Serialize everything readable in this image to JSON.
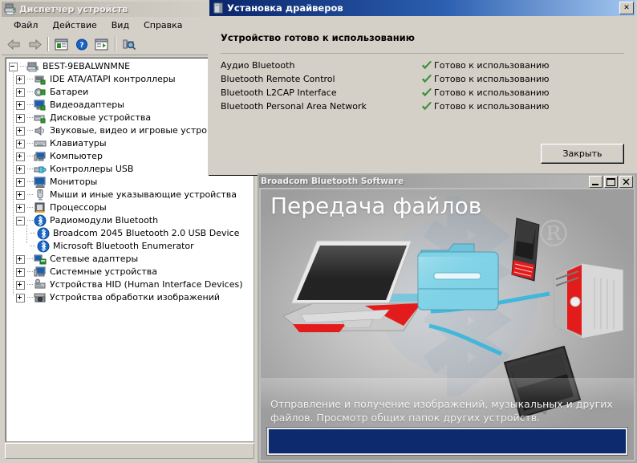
{
  "device_manager": {
    "title": "Диспетчер устройств",
    "title_icon": "device-manager-icon",
    "menu": [
      {
        "label": "Файл"
      },
      {
        "label": "Действие"
      },
      {
        "label": "Вид"
      },
      {
        "label": "Справка"
      }
    ],
    "toolbar": [
      {
        "name": "back-button",
        "icon": "left-arrow-icon"
      },
      {
        "name": "forward-button",
        "icon": "right-arrow-icon"
      },
      {
        "name": "properties-button",
        "icon": "window-properties-icon"
      },
      {
        "name": "help-button",
        "icon": "question-mark-icon"
      },
      {
        "name": "scan-button",
        "icon": "window-play-icon"
      },
      {
        "name": "scan-hardware-button",
        "icon": "scan-hardware-icon"
      }
    ],
    "tree": {
      "root": {
        "label": "BEST-9EBALWNMNE",
        "icon": "computer-icon",
        "expanded": true
      },
      "nodes": [
        {
          "label": "IDE ATA/ATAPI контроллеры",
          "icon": "ide-controller-icon",
          "expanded": false,
          "level": 1
        },
        {
          "label": "Батареи",
          "icon": "battery-icon",
          "expanded": false,
          "level": 1
        },
        {
          "label": "Видеоадаптеры",
          "icon": "display-adapter-icon",
          "expanded": false,
          "level": 1
        },
        {
          "label": "Дисковые устройства",
          "icon": "disk-drive-icon",
          "expanded": false,
          "level": 1
        },
        {
          "label": "Звуковые, видео и игровые устройства",
          "icon": "sound-device-icon",
          "expanded": false,
          "level": 1
        },
        {
          "label": "Клавиатуры",
          "icon": "keyboard-icon",
          "expanded": false,
          "level": 1
        },
        {
          "label": "Компьютер",
          "icon": "computer-node-icon",
          "expanded": false,
          "level": 1
        },
        {
          "label": "Контроллеры USB",
          "icon": "usb-controller-icon",
          "expanded": false,
          "level": 1
        },
        {
          "label": "Мониторы",
          "icon": "monitor-icon",
          "expanded": false,
          "level": 1
        },
        {
          "label": "Мыши и иные указывающие устройства",
          "icon": "mouse-icon",
          "expanded": false,
          "level": 1
        },
        {
          "label": "Процессоры",
          "icon": "processor-icon",
          "expanded": false,
          "level": 1
        },
        {
          "label": "Радиомодули Bluetooth",
          "icon": "bluetooth-icon",
          "expanded": true,
          "level": 1
        },
        {
          "label": "Broadcom 2045 Bluetooth 2.0 USB Device",
          "icon": "bluetooth-icon",
          "leaf": true,
          "level": 2
        },
        {
          "label": "Microsoft Bluetooth Enumerator",
          "icon": "bluetooth-icon",
          "leaf": true,
          "level": 2
        },
        {
          "label": "Сетевые адаптеры",
          "icon": "network-adapter-icon",
          "expanded": false,
          "level": 1
        },
        {
          "label": "Системные устройства",
          "icon": "system-device-icon",
          "expanded": false,
          "level": 1
        },
        {
          "label": "Устройства HID (Human Interface Devices)",
          "icon": "hid-device-icon",
          "expanded": false,
          "level": 1
        },
        {
          "label": "Устройства обработки изображений",
          "icon": "imaging-device-icon",
          "expanded": false,
          "level": 1
        }
      ]
    },
    "status_text": ""
  },
  "driver_dialog": {
    "title": "Установка драйверов",
    "title_icon": "driver-install-icon",
    "close_label": "✕",
    "heading": "Устройство готово к использованию",
    "items": [
      {
        "device": "Аудио Bluetooth",
        "status": "Готово к использованию",
        "icon": "green-check-icon"
      },
      {
        "device": "Bluetooth Remote Control",
        "status": "Готово к использованию",
        "icon": "green-check-icon"
      },
      {
        "device": "Bluetooth L2CAP Interface",
        "status": "Готово к использованию",
        "icon": "green-check-icon"
      },
      {
        "device": "Bluetooth Personal Area Network",
        "status": "Готово к использованию",
        "icon": "green-check-icon"
      }
    ],
    "close_button": "Закрыть",
    "accent_color": "#0a246a",
    "check_color": "#3ba83b"
  },
  "broadcom": {
    "title": "Broadcom Bluetooth Software",
    "window_buttons": [
      {
        "name": "minimize-button",
        "glyph": "_"
      },
      {
        "name": "maximize-button",
        "glyph": "□"
      },
      {
        "name": "close-button",
        "glyph": "✕"
      }
    ],
    "heading": "Передача файлов",
    "caption": "Отправление и получение изображений, музыкальных и других файлов. Просмотр общих папок других устройств.",
    "progress_value": "",
    "progress_color": "#0e2a6e",
    "illustration": {
      "laptop": "laptop-illustration",
      "folder": "shared-folder-illustration",
      "phone": "mobile-phone-illustration",
      "pc_tower": "desktop-tower-illustration",
      "tablet": "tablet-illustration",
      "bluetooth_logo": "bluetooth-logo-watermark",
      "registered_mark": "®"
    }
  }
}
